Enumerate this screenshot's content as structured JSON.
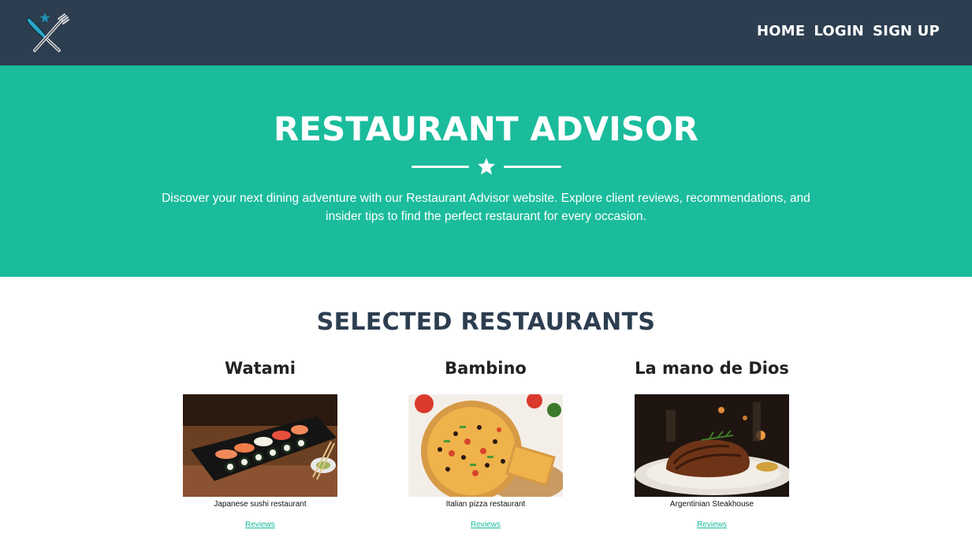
{
  "nav": {
    "logo_icon": "crossed-knife-fork-star-icon",
    "links": [
      "HOME",
      "LOGIN",
      "SIGN UP"
    ]
  },
  "hero": {
    "title": "RESTAURANT ADVISOR",
    "divider_icon": "star-icon",
    "description": "Discover your next dining adventure with our Restaurant Advisor website. Explore client reviews, recommendations, and insider tips to find the perfect restaurant for every occasion."
  },
  "section": {
    "title": "SELECTED RESTAURANTS"
  },
  "restaurants": [
    {
      "name": "Watami",
      "description": "Japanese sushi restaurant",
      "link": "Reviews",
      "image": "sushi-platter-photo"
    },
    {
      "name": "Bambino",
      "description": "Italian pizza restaurant",
      "link": "Reviews",
      "image": "pizza-photo"
    },
    {
      "name": "La mano de Dios",
      "description": "Argentinian Steakhouse",
      "link": "Reviews",
      "image": "grilled-steak-photo"
    }
  ],
  "colors": {
    "navbar": "#2c3e50",
    "accent": "#1abc9c",
    "heading": "#2c3e50"
  }
}
